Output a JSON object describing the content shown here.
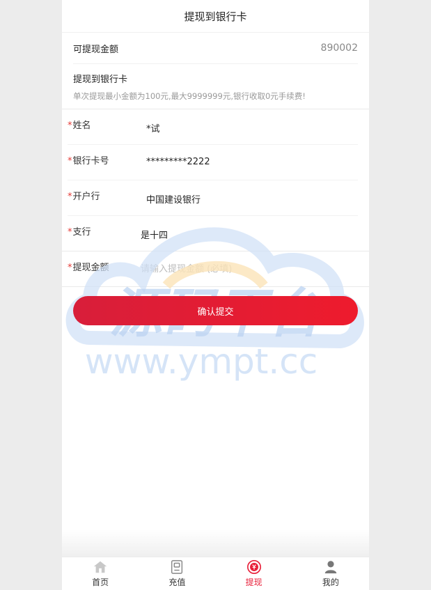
{
  "header": {
    "title": "提现到银行卡"
  },
  "balance": {
    "label": "可提现金额",
    "value": "890002"
  },
  "notice": {
    "title": "提现到银行卡",
    "desc": "单次提现最小金额为100元,最大9999999元,银行收取0元手续费!"
  },
  "form": {
    "required_mark": "*",
    "name": {
      "label": "姓名",
      "value": "*试"
    },
    "card": {
      "label": "银行卡号",
      "value": "*********2222"
    },
    "bank": {
      "label": "开户行",
      "value": "中国建设银行"
    },
    "branch": {
      "label": "支行",
      "value": "是十四"
    },
    "amount": {
      "label": "提现金额",
      "value": "",
      "placeholder": "请输入提现金额 (必填)"
    }
  },
  "submit_label": "确认提交",
  "watermark": {
    "title": "源码平台",
    "url": "www.ympt.cc"
  },
  "tabbar": {
    "items": [
      {
        "label": "首页",
        "icon": "home-icon"
      },
      {
        "label": "充值",
        "icon": "recharge-icon"
      },
      {
        "label": "提现",
        "icon": "withdraw-icon"
      },
      {
        "label": "我的",
        "icon": "user-icon"
      }
    ],
    "active_index": 2,
    "active_color": "#e8203a"
  },
  "colors": {
    "accent": "#e8203a",
    "required": "#e53935"
  }
}
